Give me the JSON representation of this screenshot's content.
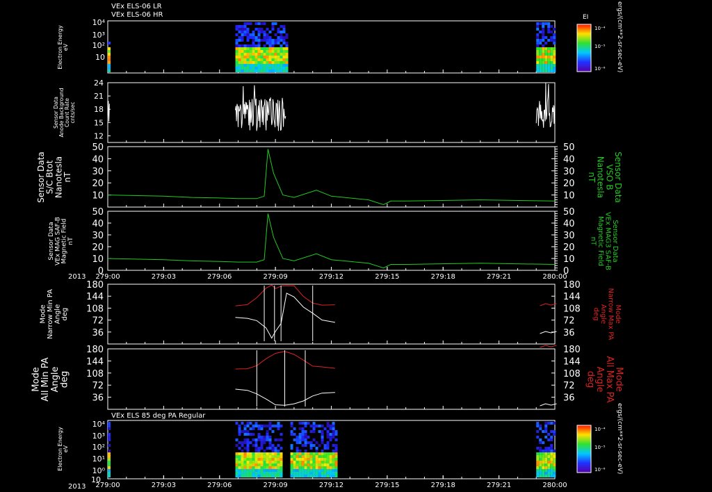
{
  "header": {
    "line1": "VEx ELS-06 LR",
    "line2": "VEx ELS-06 HR",
    "panel7_title": "VEx ELS 85 deg PA Regular"
  },
  "colors": {
    "green": "#22cc22",
    "red": "#dd2222",
    "white": "#ffffff"
  },
  "time_axis": {
    "year": "2013",
    "ticks": [
      "279:00",
      "279:03",
      "279:06",
      "279:09",
      "279:12",
      "279:15",
      "279:18",
      "279:21",
      "280:00"
    ]
  },
  "colorbar": {
    "title": "EI",
    "units": "ergs/(cm**2-sr-sec-eV)",
    "tick_labels": [
      "10⁻⁴",
      "10⁻⁵",
      "10⁻⁶"
    ]
  },
  "chart_data": [
    {
      "type": "heatmap",
      "ylabel": [
        "Electron Energy",
        "eV"
      ],
      "yscale": "log",
      "yticks": [
        "10⁴",
        "10³",
        "10²",
        "10"
      ],
      "data_segments_hours": [
        [
          0.0,
          0.05
        ],
        [
          6.85,
          9.55
        ],
        [
          23.0,
          24.0
        ]
      ]
    },
    {
      "type": "line",
      "ylabel": [
        "Sensor Data",
        "Anode Background",
        "Count Rate",
        "cnts/sec"
      ],
      "ylim": [
        10.5,
        24
      ],
      "yticks": [
        "24",
        "21",
        "18",
        "15",
        "12"
      ],
      "series": [
        {
          "color": "white",
          "segments_hours": [
            [
              0.0,
              0.1
            ],
            [
              6.85,
              9.55
            ],
            [
              23.0,
              24.0
            ]
          ],
          "range": [
            11,
            23
          ]
        }
      ]
    },
    {
      "type": "line",
      "ylabel_left": [
        "Sensor Data",
        "S/C Btot",
        "Nanotesla",
        "nT"
      ],
      "ylabel_right": [
        "Sensor Data",
        "VSO B",
        "Nanotesla",
        "nT"
      ],
      "ylim": [
        0,
        50
      ],
      "yticks": [
        "50",
        "40",
        "30",
        "20",
        "10"
      ],
      "series": [
        {
          "color": "green",
          "x": [
            0,
            3,
            4.5,
            6,
            7,
            8,
            8.4,
            8.6,
            8.9,
            9.4,
            10,
            11.2,
            12,
            14,
            14.8,
            15.2,
            16,
            20,
            24
          ],
          "y": [
            10,
            9,
            8,
            7.5,
            7,
            7,
            9,
            48,
            28,
            10,
            8,
            14,
            9,
            6,
            2,
            5,
            5,
            6,
            5
          ]
        }
      ]
    },
    {
      "type": "line",
      "ylabel_left": [
        "Sensor Data",
        "VEx MAG SAF-B",
        "Magnetic Field",
        "nT"
      ],
      "ylabel_right": [
        "Sensor Data",
        "VEx MAG3 SAF-B",
        "Magnetic Field",
        "nT"
      ],
      "ylim": [
        0,
        50
      ],
      "yticks": [
        "50",
        "40",
        "30",
        "20",
        "10",
        "0"
      ],
      "series": [
        {
          "color": "green",
          "x": [
            0,
            3,
            4.5,
            6,
            7,
            8,
            8.4,
            8.6,
            8.9,
            9.4,
            10,
            11.2,
            12,
            14,
            14.8,
            15.2,
            16,
            20,
            24
          ],
          "y": [
            10,
            9,
            8,
            7.5,
            7,
            7,
            9,
            48,
            28,
            10,
            8,
            14,
            9,
            6,
            2,
            5,
            5,
            6,
            5
          ]
        }
      ]
    },
    {
      "type": "line",
      "ylabel_left": [
        "Mode",
        "Narrow Min PA",
        "Angle",
        "deg"
      ],
      "ylabel_right": [
        "Mode",
        "Narrow Max PA",
        "Angle",
        "deg"
      ],
      "ylim": [
        0,
        180
      ],
      "yticks": [
        "180",
        "144",
        "108",
        "72",
        "36"
      ],
      "series": [
        {
          "name": "Narrow Min PA",
          "color": "white",
          "x": [
            6.85,
            7.5,
            8.0,
            8.5,
            8.8,
            9.0,
            9.3,
            9.6,
            10,
            10.5,
            11,
            11.5,
            12.2
          ],
          "y": [
            80,
            75,
            70,
            50,
            20,
            40,
            60,
            150,
            140,
            110,
            90,
            75,
            65
          ]
        },
        {
          "name": "Narrow Max PA",
          "color": "red",
          "x": [
            6.85,
            7.5,
            8.0,
            8.5,
            8.8,
            9.0,
            9.3,
            9.6,
            10,
            10.5,
            11,
            11.5,
            12.2
          ],
          "y": [
            115,
            120,
            140,
            170,
            175,
            165,
            172,
            178,
            175,
            145,
            125,
            120,
            118
          ]
        }
      ]
    },
    {
      "type": "line",
      "ylabel_left": [
        "Mode",
        "All Min PA",
        "Angle",
        "deg"
      ],
      "ylabel_right": [
        "Mode",
        "All Max PA",
        "Angle",
        "deg"
      ],
      "ylim": [
        0,
        180
      ],
      "yticks": [
        "180",
        "144",
        "108",
        "72",
        "36"
      ],
      "series": [
        {
          "name": "All Min PA",
          "color": "white",
          "x": [
            6.85,
            7.5,
            8.0,
            8.5,
            9.0,
            9.5,
            10,
            10.5,
            11,
            11.5,
            12.2
          ],
          "y": [
            60,
            55,
            45,
            30,
            15,
            10,
            15,
            25,
            40,
            50,
            50
          ]
        },
        {
          "name": "All Max PA",
          "color": "red",
          "x": [
            6.85,
            7.5,
            8.0,
            8.5,
            9.0,
            9.5,
            10,
            10.5,
            11,
            11.5,
            12.2
          ],
          "y": [
            120,
            122,
            130,
            150,
            165,
            172,
            165,
            145,
            130,
            125,
            122
          ]
        }
      ]
    },
    {
      "type": "heatmap",
      "ylabel": [
        "Electron Energy",
        "eV"
      ],
      "yscale": "log",
      "yticks": [
        "10⁴",
        "10³",
        "10²",
        "10¹",
        "10⁰"
      ],
      "data_segments_hours": [
        [
          0.0,
          0.05
        ],
        [
          6.85,
          9.3
        ],
        [
          9.8,
          12.2
        ],
        [
          23.0,
          24.0
        ]
      ]
    }
  ]
}
